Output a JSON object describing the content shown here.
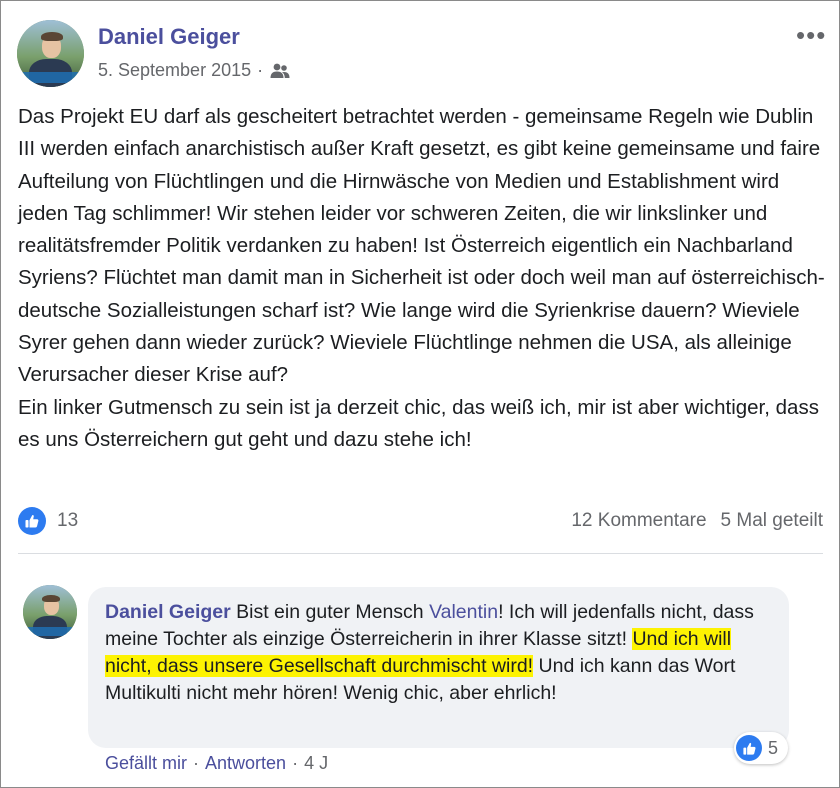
{
  "post": {
    "author": "Daniel Geiger",
    "date": "5. September 2015",
    "separator": "·",
    "audience_icon": "friends-icon",
    "more_icon": "more-options-icon",
    "paragraph1": "Das Projekt EU darf als gescheitert betrachtet werden - gemeinsame Regeln wie Dublin III werden einfach anarchistisch außer Kraft gesetzt, es gibt keine gemeinsame und faire Aufteilung von Flüchtlingen und die Hirnwäsche von Medien und Establishment wird jeden Tag schlimmer! Wir stehen leider vor schweren Zeiten, die wir linkslinker und realitätsfremder Politik verdanken zu haben! Ist Österreich eigentlich ein Nachbarland Syriens? Flüchtet man damit man in Sicherheit ist oder doch weil man auf österreichisch-deutsche Sozialleistungen scharf ist? Wie lange wird die Syrienkrise dauern? Wieviele Syrer gehen dann wieder zurück? Wieviele Flüchtlinge nehmen die USA, als alleinige Verursacher dieser Krise auf?",
    "paragraph2": "Ein linker Gutmensch zu sein ist ja derzeit chic, das weiß ich, mir ist aber wichtiger, dass es uns Österreichern gut geht und dazu stehe ich!",
    "like_icon": "thumbs-up-icon",
    "likes": "13",
    "comments": "12 Kommentare",
    "shares": "5 Mal geteilt"
  },
  "comment": {
    "author": "Daniel Geiger",
    "text_before_mention": " Bist ein guter Mensch ",
    "mention": "Valentin",
    "text_after_mention": "! Ich will jedenfalls nicht, dass meine Tochter als einzige Österreicherin in ihrer Klasse sitzt! ",
    "highlighted": "Und ich will nicht, dass unsere Gesellschaft durchmischt wird!",
    "text_end": " Und ich kann das Wort Multikulti nicht mehr hören! Wenig chic, aber ehrlich!",
    "reaction_count": "5",
    "like_action": "Gefällt mir",
    "reply_action": "Antworten",
    "separator": "·",
    "age": "4 J"
  },
  "colors": {
    "name": "#4b4f9d",
    "like_blue": "#2d7bf0",
    "highlight": "#fdf302",
    "bubble": "#f0f2f5"
  }
}
